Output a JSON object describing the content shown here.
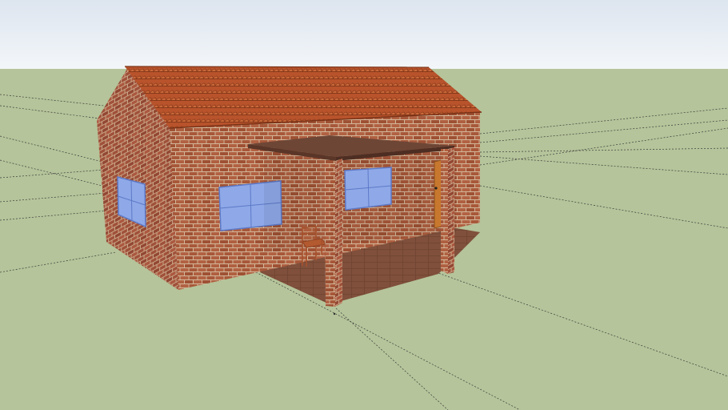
{
  "app": {
    "window_title": ""
  },
  "scene": {
    "sky_top_color": "#dde5ef",
    "sky_bottom_color": "#f3f6f9",
    "ground_color": "#b5c49a",
    "guide_line_color": "#3c3c3c",
    "wall_color": "#a8583a",
    "wall_shadow_color": "#8f4930",
    "mortar_color": "#d3b79a",
    "roof_color": "#b8532c",
    "roof_tile_line_color": "#8a3a1a",
    "window_glass_color": "#8fa9e8",
    "window_frame_color": "#5d79c7",
    "door_color": "#c8782e",
    "porch_floor_color": "#7d4a37",
    "porch_roof_color": "#6e4636"
  },
  "model": {
    "parts": [
      "roof",
      "side-wall",
      "front-wall",
      "porch-roof",
      "porch-column-left",
      "porch-column-right",
      "porch-floor",
      "side-window",
      "front-window-left",
      "front-window-right",
      "front-door",
      "chair"
    ]
  }
}
